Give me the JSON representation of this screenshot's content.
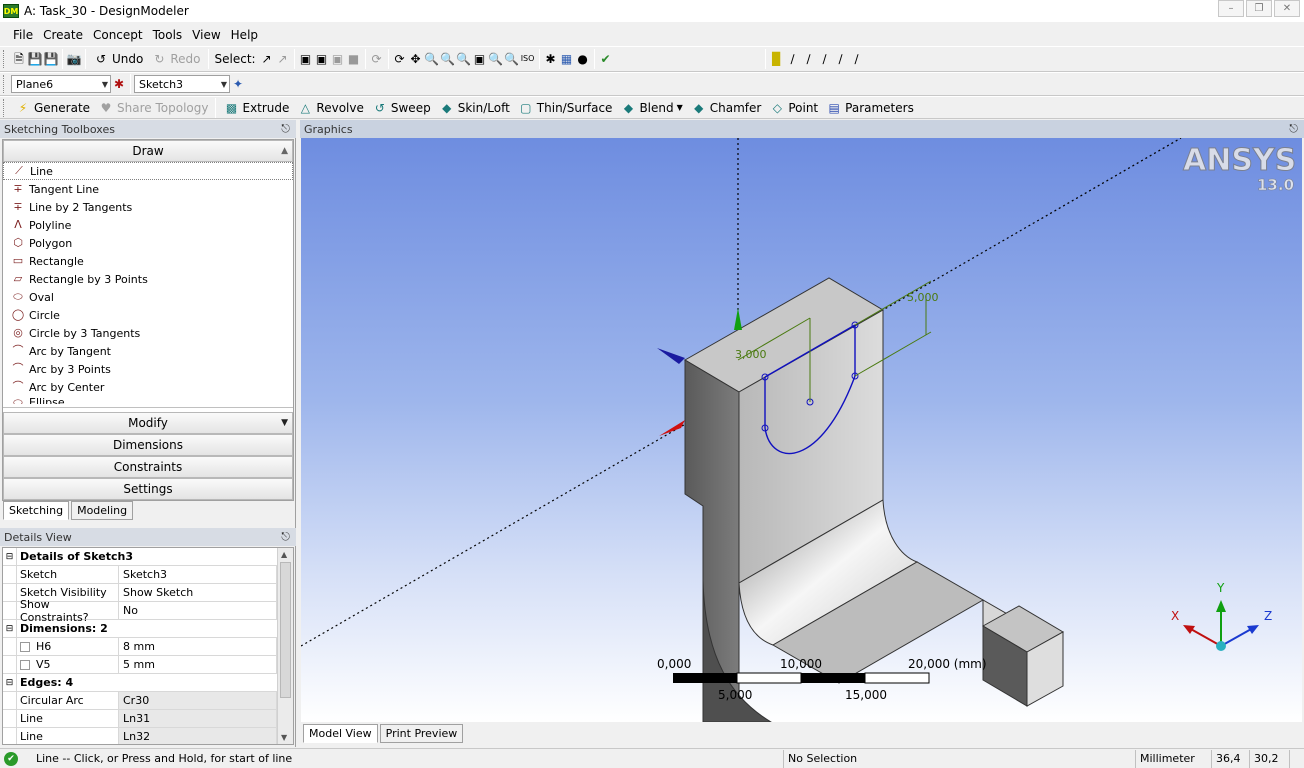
{
  "window": {
    "title": "A: Task_30 - DesignModeler",
    "icon_text": "DM"
  },
  "menu": [
    "File",
    "Create",
    "Concept",
    "Tools",
    "View",
    "Help"
  ],
  "toolbar1": {
    "undo": "Undo",
    "redo": "Redo",
    "select_label": "Select:"
  },
  "toolbar2": {
    "plane": "Plane6",
    "sketch": "Sketch3"
  },
  "toolbar3": {
    "generate": "Generate",
    "share_topology": "Share Topology",
    "extrude": "Extrude",
    "revolve": "Revolve",
    "sweep": "Sweep",
    "skin_loft": "Skin/Loft",
    "thin_surface": "Thin/Surface",
    "blend": "Blend",
    "chamfer": "Chamfer",
    "point": "Point",
    "parameters": "Parameters"
  },
  "sketching_toolboxes": {
    "header": "Sketching Toolboxes",
    "draw": "Draw",
    "tools": [
      "Line",
      "Tangent Line",
      "Line by 2 Tangents",
      "Polyline",
      "Polygon",
      "Rectangle",
      "Rectangle by 3 Points",
      "Oval",
      "Circle",
      "Circle by 3 Tangents",
      "Arc by Tangent",
      "Arc by 3 Points",
      "Arc by Center",
      "Ellipse"
    ],
    "modify": "Modify",
    "dimensions": "Dimensions",
    "constraints": "Constraints",
    "settings": "Settings"
  },
  "left_tabs": {
    "sketching": "Sketching",
    "modeling": "Modeling"
  },
  "details": {
    "header": "Details View",
    "group1": "Details of Sketch3",
    "sketch_k": "Sketch",
    "sketch_v": "Sketch3",
    "vis_k": "Sketch Visibility",
    "vis_v": "Show Sketch",
    "cons_k": "Show Constraints?",
    "cons_v": "No",
    "group2": "Dimensions: 2",
    "h6_k": "H6",
    "h6_v": "8 mm",
    "v5_k": "V5",
    "v5_v": "5 mm",
    "group3": "Edges: 4",
    "e1_k": "Circular Arc",
    "e1_v": "Cr30",
    "e2_k": "Line",
    "e2_v": "Ln31",
    "e3_k": "Line",
    "e3_v": "Ln32"
  },
  "graphics": {
    "header": "Graphics",
    "logo": "ANSYS",
    "version": "13.0",
    "dim_a": "3,000",
    "dim_b": "5,000",
    "scale": {
      "s0": "0,000",
      "s10": "10,000",
      "s20": "20,000 (mm)",
      "s5": "5,000",
      "s15": "15,000"
    },
    "triad": {
      "x": "X",
      "y": "Y",
      "z": "Z"
    }
  },
  "view_tabs": {
    "model": "Model View",
    "print": "Print Preview"
  },
  "status": {
    "message": "Line -- Click, or Press and Hold, for start of line",
    "selection": "No Selection",
    "units": "Millimeter",
    "x": "36,4",
    "y": "30,2"
  }
}
